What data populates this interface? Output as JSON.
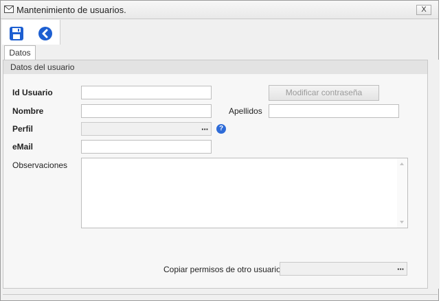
{
  "window": {
    "title": "Mantenimiento de usuarios.",
    "close_label": "X"
  },
  "toolbar": {
    "save_icon": "save-icon",
    "back_icon": "back-icon"
  },
  "tabs": [
    {
      "label": "Datos"
    }
  ],
  "group": {
    "header": "Datos del usuario"
  },
  "form": {
    "id_usuario_label": "Id Usuario",
    "id_usuario_value": "",
    "modificar_button": "Modificar contraseña",
    "nombre_label": "Nombre",
    "nombre_value": "",
    "apellidos_label": "Apellidos",
    "apellidos_value": "",
    "perfil_label": "Perfil",
    "perfil_value": "",
    "ellipsis": "···",
    "help": "?",
    "email_label": "eMail",
    "email_value": "",
    "observaciones_label": "Observaciones",
    "observaciones_value": "",
    "copiar_label": "Copiar permisos de otro usuario",
    "copiar_value": ""
  },
  "colors": {
    "accent_blue": "#1d5fd1",
    "help_blue": "#2f6cd8",
    "window_bg": "#f0f0f0"
  }
}
